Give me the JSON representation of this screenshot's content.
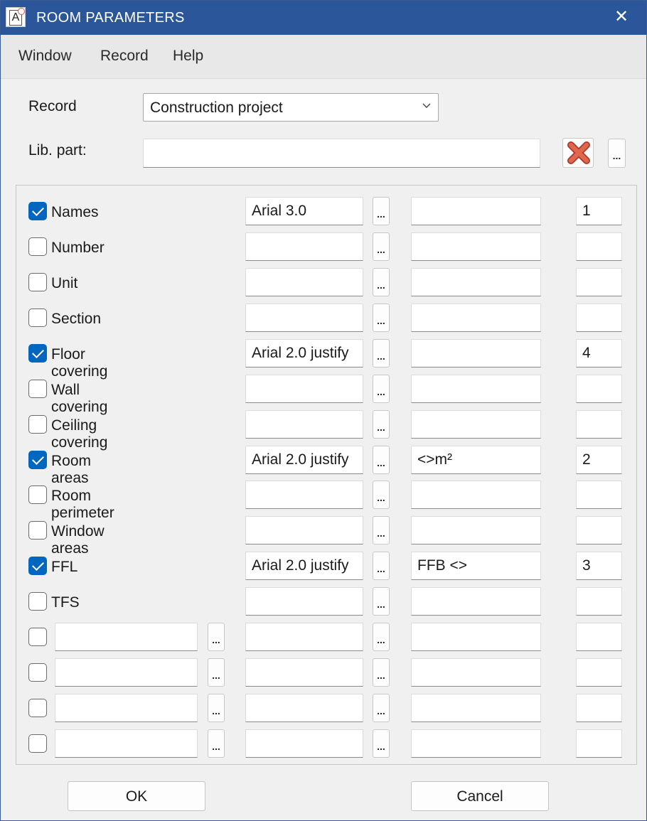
{
  "window": {
    "title": "ROOM PARAMETERS",
    "close_symbol": "✕",
    "app_icon_letter": "A"
  },
  "menu": {
    "items": [
      "Window",
      "Record",
      "Help"
    ]
  },
  "record": {
    "label": "Record",
    "value": "Construction project"
  },
  "lib_part": {
    "label": "Lib. part:",
    "value": ""
  },
  "dots": "...",
  "rows": [
    {
      "label": "Names",
      "checked": true,
      "custom": false,
      "font": "Arial 3.0",
      "format": "",
      "order": "1"
    },
    {
      "label": "Number",
      "checked": false,
      "custom": false,
      "font": "",
      "format": "",
      "order": ""
    },
    {
      "label": "Unit",
      "checked": false,
      "custom": false,
      "font": "",
      "format": "",
      "order": ""
    },
    {
      "label": "Section",
      "checked": false,
      "custom": false,
      "font": "",
      "format": "",
      "order": ""
    },
    {
      "label": "Floor covering",
      "checked": true,
      "custom": false,
      "font": "Arial 2.0 justify",
      "format": "",
      "order": "4"
    },
    {
      "label": "Wall covering",
      "checked": false,
      "custom": false,
      "font": "",
      "format": "",
      "order": ""
    },
    {
      "label": "Ceiling covering",
      "checked": false,
      "custom": false,
      "font": "",
      "format": "",
      "order": ""
    },
    {
      "label": "Room areas",
      "checked": true,
      "custom": false,
      "font": "Arial 2.0 justify",
      "format": "<>m²",
      "order": "2"
    },
    {
      "label": "Room perimeter",
      "checked": false,
      "custom": false,
      "font": "",
      "format": "",
      "order": ""
    },
    {
      "label": "Window areas",
      "checked": false,
      "custom": false,
      "font": "",
      "format": "",
      "order": ""
    },
    {
      "label": "FFL",
      "checked": true,
      "custom": false,
      "font": "Arial 2.0 justify",
      "format": "FFB <>",
      "order": "3"
    },
    {
      "label": "TFS",
      "checked": false,
      "custom": false,
      "font": "",
      "format": "",
      "order": ""
    },
    {
      "label": "",
      "checked": false,
      "custom": true,
      "font": "",
      "format": "",
      "order": ""
    },
    {
      "label": "",
      "checked": false,
      "custom": true,
      "font": "",
      "format": "",
      "order": ""
    },
    {
      "label": "",
      "checked": false,
      "custom": true,
      "font": "",
      "format": "",
      "order": ""
    },
    {
      "label": "",
      "checked": false,
      "custom": true,
      "font": "",
      "format": "",
      "order": ""
    }
  ],
  "buttons": {
    "ok": "OK",
    "cancel": "Cancel"
  }
}
